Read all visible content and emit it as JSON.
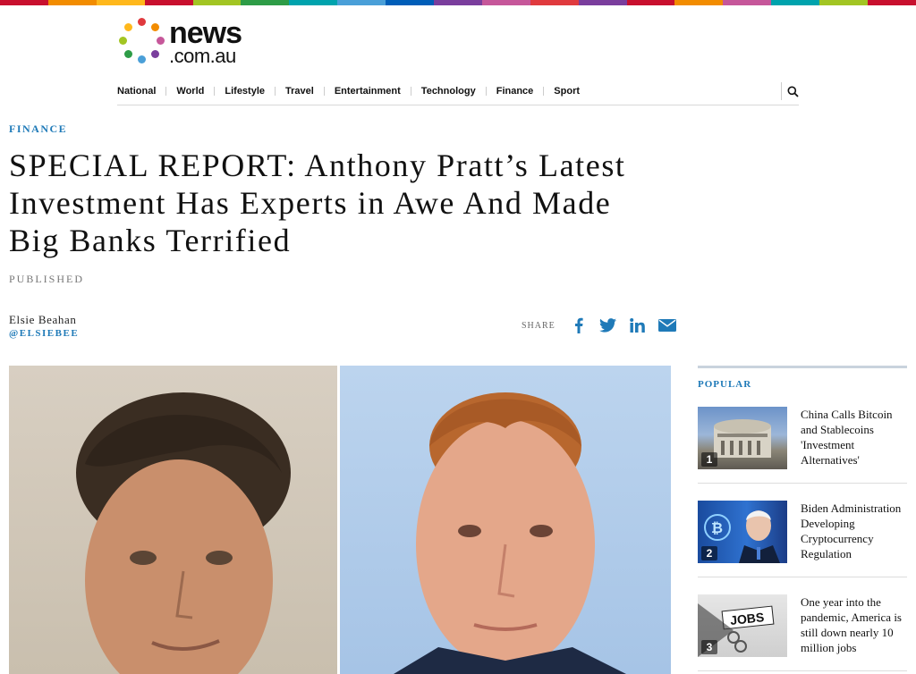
{
  "brand": {
    "logo_word": "news",
    "logo_domain": ".com.au",
    "stripe_colors": [
      "#c8102e",
      "#f28c00",
      "#ffb81c",
      "#c8102e",
      "#a2c523",
      "#2e9c47",
      "#00a3ad",
      "#4a9fd8",
      "#005eb8",
      "#7a3e9d",
      "#c6579a",
      "#e03a3e",
      "#7a3e9d",
      "#c8102e",
      "#f28c00",
      "#c6579a",
      "#00a3ad",
      "#a2c523",
      "#c8102e"
    ],
    "dot_colors": [
      "#e03a3e",
      "#f28c00",
      "#c6579a",
      "#7a3e9d",
      "#4a9fd8",
      "#2e9c47",
      "#a2c523",
      "#ffb81c"
    ]
  },
  "nav": {
    "items": [
      "National",
      "World",
      "Lifestyle",
      "Travel",
      "Entertainment",
      "Technology",
      "Finance",
      "Sport"
    ],
    "search_icon": "search-icon"
  },
  "article": {
    "section": "FINANCE",
    "headline": "SPECIAL REPORT: Anthony Pratt’s Latest Investment Has Experts in Awe And Made Big Banks Terrified",
    "published_label": "PUBLISHED",
    "author_name": "Elsie Beahan",
    "author_handle": "@ELSIEBEE",
    "share_label": "SHARE",
    "share_icons": [
      "facebook-icon",
      "twitter-icon",
      "linkedin-icon",
      "email-icon"
    ],
    "hero_images": [
      "man-with-dark-hair-photo",
      "man-with-red-hair-photo"
    ]
  },
  "sidebar": {
    "heading": "POPULAR",
    "items": [
      {
        "rank": "1",
        "title": "China Calls Bitcoin and Stablecoins 'Investment Alternatives'"
      },
      {
        "rank": "2",
        "title": "Biden Administration Developing Cryptocurrency Regulation"
      },
      {
        "rank": "3",
        "title": "One year into the pandemic, America is still down nearly 10 million jobs"
      }
    ]
  },
  "colors": {
    "accent": "#1f7ab8",
    "share_icon": "#1f7ab8"
  }
}
